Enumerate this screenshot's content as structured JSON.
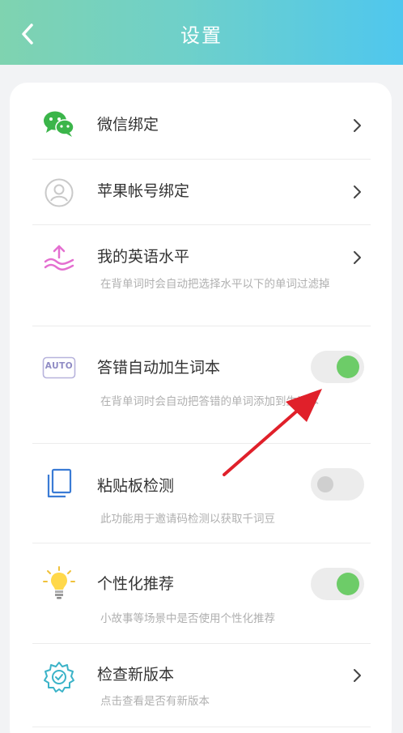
{
  "header": {
    "title": "设置"
  },
  "settings": {
    "wechat": {
      "label": "微信绑定"
    },
    "apple": {
      "label": "苹果帐号绑定"
    },
    "english_level": {
      "label": "我的英语水平",
      "desc": "在背单词时会自动把选择水平以下的单词过滤掉"
    },
    "auto_add": {
      "label": "答错自动加生词本",
      "desc": "在背单词时会自动把答错的单词添加到生词本",
      "enabled": true,
      "icon_text": "AUTO"
    },
    "clipboard": {
      "label": "粘贴板检测",
      "desc": "此功能用于邀请码检测以获取千词豆",
      "enabled": false
    },
    "personalized": {
      "label": "个性化推荐",
      "desc": "小故事等场景中是否使用个性化推荐",
      "enabled": true
    },
    "update": {
      "label": "检查新版本",
      "desc": "点击查看是否有新版本"
    }
  },
  "colors": {
    "header_start": "#7fd3b0",
    "header_end": "#4fc7ee",
    "toggle_on": "#6dcc68",
    "annotation_arrow": "#e0202a"
  }
}
